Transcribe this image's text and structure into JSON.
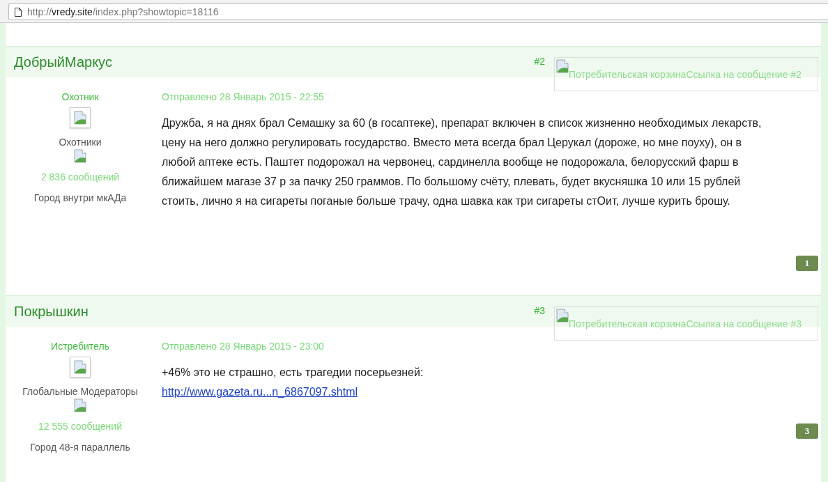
{
  "address_bar": {
    "scheme": "http://",
    "host": "vredy.site",
    "path": "/index.php?showtopic=18116"
  },
  "posts": [
    {
      "author": "ДобрыйМаркус",
      "number": "#2",
      "link_image_alt": "Потребительская корзинаСсылка на сообщение #2",
      "rank": "Охотник",
      "group": "Охотники",
      "post_count": "2 836 сообщений",
      "location": "Город внутри мкАДа",
      "date": "Отправлено 28 Январь 2015 - 22:55",
      "content": [
        {
          "kind": "text",
          "text": "Дружба, я на днях брал Семашку за 60 (в госаптеке), препарат включен в список жизненно необходимых лекарств, цену на него должно регулировать государство. Вместо мета всегда брал Церукал (дороже, но мне поуху), он в любой аптеке есть. Паштет подорожал на червонец, сардинелла вообще не подорожала, белорусский фарш в ближайшем магазе 37 р за пачку 250 граммов. По большому счёту, плевать, будет вкусняшка 10 или 15 рублей стоить, лично я на сигареты поганые больше трачу, одна шавка как три сигареты стОит, лучше курить брошу."
        }
      ],
      "reputation": "1"
    },
    {
      "author": "Покрышкин",
      "number": "#3",
      "link_image_alt": "Потребительская корзинаСсылка на сообщение #3",
      "rank": "Истребитель",
      "group": "Глобальные Модераторы",
      "post_count": "12 555 сообщений",
      "location": "Город 48-я параллель",
      "date": "Отправлено 28 Январь 2015 - 23:00",
      "content": [
        {
          "kind": "text",
          "text": "+46% это не страшно, есть трагедии посерьезней:"
        },
        {
          "kind": "link",
          "text": "http://www.gazeta.ru...n_6867097.shtml"
        }
      ],
      "reputation": "3"
    }
  ]
}
